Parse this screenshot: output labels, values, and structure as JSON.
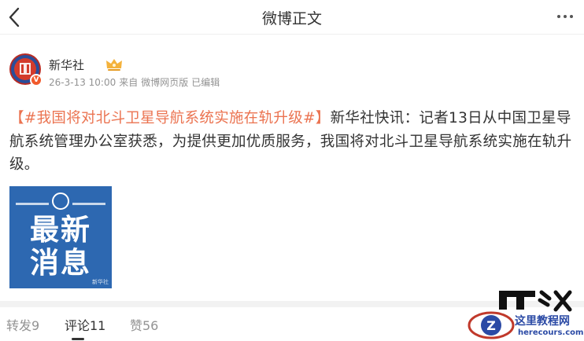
{
  "header": {
    "title": "微博正文",
    "back_icon": "chevron-left-icon",
    "more_icon": "ellipsis-icon"
  },
  "author": {
    "name": "新华社",
    "avatar_label": "新华社",
    "verified_badge": "V",
    "crown_icon": "crown-icon",
    "meta": {
      "time": "26-3-13 10:00",
      "source_prefix": "来自",
      "source": "微博网页版",
      "edited": "已编辑"
    }
  },
  "post": {
    "topic": "【#我国将对北斗卫星导航系统实施在轨升级#】",
    "body": "新华社快讯：记者13日从中国卫星导航系统管理办公室获悉，为提供更加优质服务，我国将对北斗卫星导航系统实施在轨升级。",
    "image": {
      "line1": "最新",
      "line2": "消息",
      "caption": "新华社"
    }
  },
  "tabs": [
    {
      "label": "转发9"
    },
    {
      "label": "评论11"
    },
    {
      "label": "赞56"
    }
  ],
  "watermark": {
    "brand": "IT之家",
    "site_name": "这里教程网",
    "site_url": "herecours.com"
  },
  "colors": {
    "topic": "#eb7350",
    "image_bg": "#2d68b1",
    "avatar_bg": "#b72b24",
    "text": "#333333",
    "meta": "#939393"
  }
}
